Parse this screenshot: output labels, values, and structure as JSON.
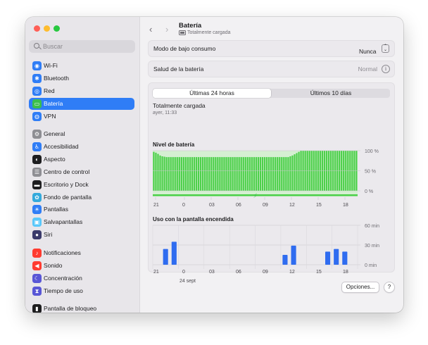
{
  "search": {
    "placeholder": "Buscar"
  },
  "sidebar": {
    "items": [
      {
        "label": "Wi-Fi",
        "icon": "wifi-icon",
        "color": "#2f7df6",
        "glyph": "◉"
      },
      {
        "label": "Bluetooth",
        "icon": "bluetooth-icon",
        "color": "#2f7df6",
        "glyph": "✱"
      },
      {
        "label": "Red",
        "icon": "globe-icon",
        "color": "#2f7df6",
        "glyph": "◎"
      },
      {
        "label": "Batería",
        "icon": "battery-icon",
        "color": "#3bbf4c",
        "glyph": "▭",
        "active": true
      },
      {
        "label": "VPN",
        "icon": "vpn-globe-icon",
        "color": "#2f7df6",
        "glyph": "◍"
      },
      {
        "label": "General",
        "icon": "gear-icon",
        "color": "#8e8e93",
        "glyph": "⚙"
      },
      {
        "label": "Accesibilidad",
        "icon": "accessibility-icon",
        "color": "#2f7df6",
        "glyph": "♿"
      },
      {
        "label": "Aspecto",
        "icon": "appearance-icon",
        "color": "#1d1d1f",
        "glyph": "◐"
      },
      {
        "label": "Centro de control",
        "icon": "control-center-icon",
        "color": "#8e8e93",
        "glyph": "☰"
      },
      {
        "label": "Escritorio y Dock",
        "icon": "dock-icon",
        "color": "#1d1d1f",
        "glyph": "▬"
      },
      {
        "label": "Fondo de pantalla",
        "icon": "wallpaper-icon",
        "color": "#34aadc",
        "glyph": "✿"
      },
      {
        "label": "Pantallas",
        "icon": "displays-icon",
        "color": "#2f7df6",
        "glyph": "☀"
      },
      {
        "label": "Salvapantallas",
        "icon": "screensaver-icon",
        "color": "#5ac8fa",
        "glyph": "▣"
      },
      {
        "label": "Siri",
        "icon": "siri-icon",
        "color": "#3a3a6a",
        "glyph": "●"
      },
      {
        "label": "Notificaciones",
        "icon": "bell-icon",
        "color": "#ff3b30",
        "glyph": "♪"
      },
      {
        "label": "Sonido",
        "icon": "speaker-icon",
        "color": "#ff3b30",
        "glyph": "◀"
      },
      {
        "label": "Concentración",
        "icon": "moon-icon",
        "color": "#5856d6",
        "glyph": "☾"
      },
      {
        "label": "Tiempo de uso",
        "icon": "hourglass-icon",
        "color": "#5856d6",
        "glyph": "⧗"
      },
      {
        "label": "Pantalla de bloqueo",
        "icon": "lock-screen-icon",
        "color": "#1d1d1f",
        "glyph": "▮"
      }
    ]
  },
  "header": {
    "title": "Batería",
    "subtitle": "Totalmente cargada"
  },
  "low_power": {
    "label": "Modo de bajo consumo",
    "value": "Nunca"
  },
  "health": {
    "label": "Salud de la batería",
    "value": "Normal"
  },
  "tabs": {
    "last24": "Últimas 24 horas",
    "last10": "Últimos 10 días"
  },
  "status": {
    "title": "Totalmente cargada",
    "time": "ayer, 11:33"
  },
  "buttons": {
    "options": "Opciones...",
    "help": "?"
  },
  "colors": {
    "accent": "#2f7df6",
    "battery_green": "#4cd04a",
    "charging_bg": "#d5efd2",
    "usage_blue": "#2f6cf0"
  },
  "chart_data": [
    {
      "type": "bar",
      "title": "Nivel de batería",
      "x_tick_labels": [
        "21",
        "0",
        "03",
        "06",
        "09",
        "12",
        "15",
        "18"
      ],
      "y_tick_labels": [
        "100 %",
        "50 %",
        "0 %"
      ],
      "ylim": [
        0,
        100
      ],
      "values": [
        97,
        95,
        92,
        88,
        86,
        85,
        84,
        84,
        84,
        84,
        84,
        84,
        84,
        84,
        84,
        84,
        84,
        84,
        84,
        84,
        84,
        84,
        84,
        84,
        84,
        84,
        84,
        84,
        84,
        84,
        84,
        84,
        84,
        84,
        84,
        84,
        84,
        84,
        84,
        84,
        84,
        84,
        84,
        84,
        84,
        84,
        84,
        84,
        84,
        84,
        84,
        84,
        84,
        84,
        84,
        84,
        84,
        84,
        84,
        84,
        84,
        84,
        84,
        84,
        86,
        88,
        91,
        94,
        97,
        100,
        100,
        100,
        100,
        100,
        100,
        100,
        100,
        100,
        100,
        100,
        100,
        100,
        100,
        100,
        100,
        100,
        100,
        100,
        100,
        100,
        100,
        100,
        100,
        100,
        100,
        100
      ],
      "charging_background": "full period"
    },
    {
      "type": "bar",
      "title": "Uso con la pantalla encendida",
      "x_tick_labels": [
        "21",
        "0",
        "03",
        "06",
        "09",
        "12",
        "15",
        "18"
      ],
      "x_sublabel": "24 sept",
      "y_tick_labels": [
        "60 min",
        "30 min",
        "0 min"
      ],
      "ylim": [
        0,
        60
      ],
      "hours": [
        "21",
        "22",
        "23",
        "0",
        "1",
        "2",
        "3",
        "4",
        "5",
        "6",
        "7",
        "8",
        "9",
        "10",
        "11",
        "12",
        "13",
        "14",
        "15",
        "16",
        "17",
        "18",
        "19",
        "20"
      ],
      "values": [
        0,
        24,
        35,
        0,
        0,
        0,
        0,
        0,
        0,
        0,
        0,
        0,
        0,
        0,
        0,
        15,
        29,
        0,
        0,
        0,
        20,
        24,
        20,
        0
      ]
    }
  ]
}
